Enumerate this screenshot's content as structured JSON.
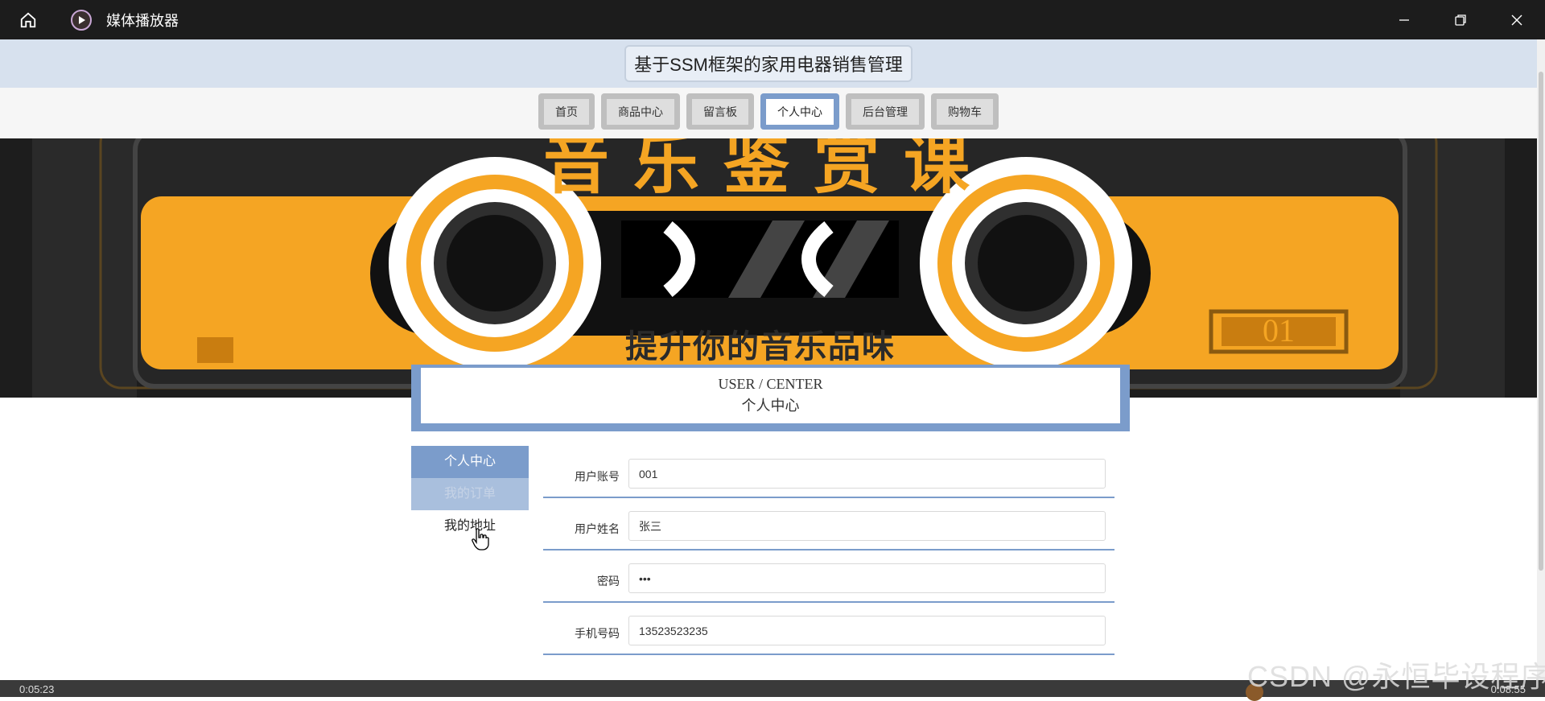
{
  "window": {
    "title": "媒体播放器",
    "icons": {
      "home": "home-icon",
      "app": "play-icon",
      "minimize": "minimize-icon",
      "restore": "restore-icon",
      "close": "close-icon"
    }
  },
  "site": {
    "title": "基于SSM框架的家用电器销售管理"
  },
  "nav": {
    "items": [
      {
        "label": "首页"
      },
      {
        "label": "商品中心"
      },
      {
        "label": "留言板"
      },
      {
        "label": "个人中心",
        "active": true
      },
      {
        "label": "后台管理"
      },
      {
        "label": "购物车"
      }
    ]
  },
  "banner": {
    "headline": "音乐鉴赏课",
    "tagline": "提升你的音乐品味",
    "tape_number": "01",
    "slides": 3,
    "active_slide": 1
  },
  "section": {
    "title_en": "USER / CENTER",
    "title_cn": "个人中心"
  },
  "side_menu": {
    "items": [
      {
        "label": "个人中心",
        "state": "active"
      },
      {
        "label": "我的订单",
        "state": "hover"
      },
      {
        "label": "我的地址",
        "state": "normal"
      }
    ]
  },
  "form": {
    "fields": [
      {
        "label": "用户账号",
        "value": "001"
      },
      {
        "label": "用户姓名",
        "value": "张三"
      },
      {
        "label": "密码",
        "value": "•••"
      },
      {
        "label": "手机号码",
        "value": "13523523235"
      }
    ]
  },
  "watermark": "CSDN @永恒毕设程序",
  "player": {
    "time_left": "0:05:23",
    "time_right": "0:08:55"
  },
  "colors": {
    "accent": "#7b9ccb",
    "banner_orange": "#f5a523",
    "header_bg": "#d7e1ee"
  }
}
